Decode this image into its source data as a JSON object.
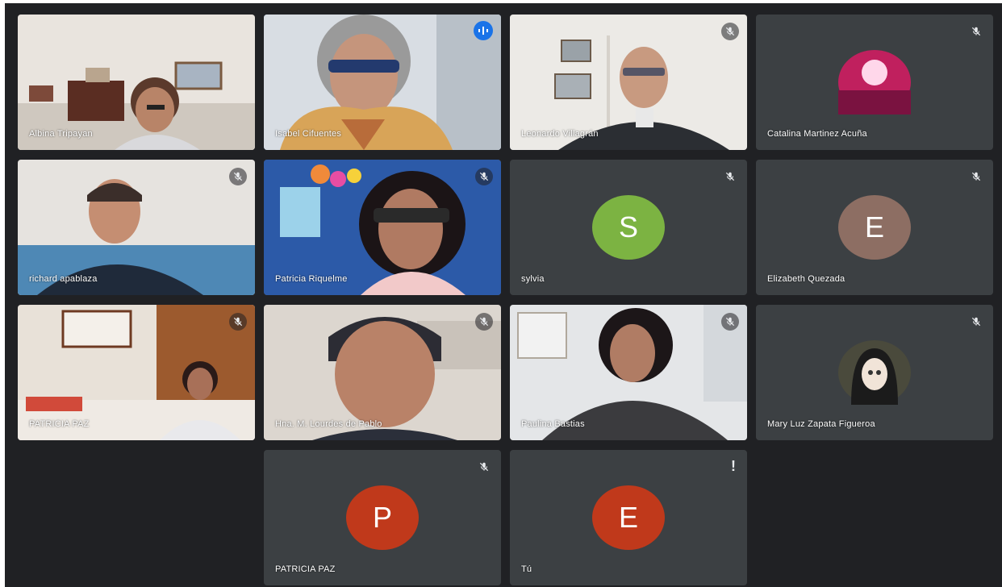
{
  "meeting": {
    "participants": [
      {
        "name": "Albina Tripayan",
        "type": "video",
        "muted": false
      },
      {
        "name": "Isabel Cifuentes",
        "type": "video",
        "speaking": true
      },
      {
        "name": "Leonardo Villagrán",
        "type": "video",
        "muted": true
      },
      {
        "name": "Catalina Martinez Acuña",
        "type": "photo",
        "muted": true
      },
      {
        "name": "richard apablaza",
        "type": "video",
        "muted": true
      },
      {
        "name": "Patricia Riquelme",
        "type": "video",
        "muted": true
      },
      {
        "name": "sylvia",
        "type": "initial",
        "initial": "S",
        "avatar_color": "#7cb342",
        "muted": true
      },
      {
        "name": "Elizabeth Quezada",
        "type": "initial",
        "initial": "E",
        "avatar_color": "#8d6e63",
        "muted": true
      },
      {
        "name": "PATRICIA PAZ",
        "type": "video",
        "muted": true
      },
      {
        "name": "Hna. M. Lourdes de Pablo",
        "type": "video",
        "muted": true
      },
      {
        "name": "Paulina Bastias",
        "type": "video",
        "muted": true
      },
      {
        "name": "Mary Luz Zapata Figueroa",
        "type": "photo",
        "muted": true
      },
      {
        "name": "PATRICIA PAZ",
        "type": "initial",
        "initial": "P",
        "avatar_color": "#c0391b",
        "muted": true
      },
      {
        "name": "Tú",
        "type": "initial",
        "initial": "E",
        "avatar_color": "#c0391b",
        "warning": true
      }
    ]
  },
  "colors": {
    "background": "#202124",
    "tile": "#3c4043",
    "speaking_border": "#8ab4f8",
    "speaking_indicator": "#1a73e8"
  },
  "icons": {
    "mute": "mic-off-icon",
    "speaking": "audio-wave-icon",
    "warning": "exclamation-icon"
  }
}
